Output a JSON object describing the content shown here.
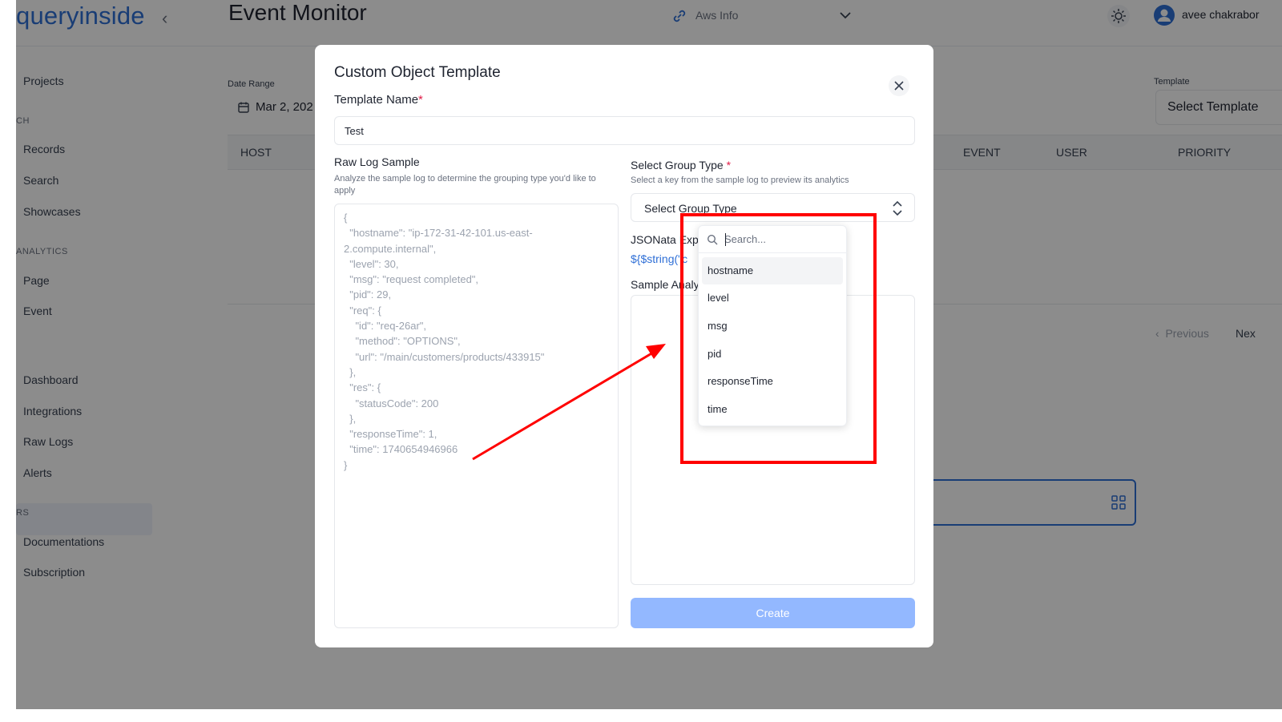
{
  "app": {
    "logo": "queryinside",
    "collapse_glyph": "‹",
    "page_title": "Event Monitor",
    "aws_selector": "Aws Info",
    "user_name": "avee chakrabor"
  },
  "sidebar": {
    "items": [
      {
        "label": "Projects"
      },
      {
        "label": "CH"
      },
      {
        "label": "Records"
      },
      {
        "label": "Search"
      },
      {
        "label": "Showcases"
      },
      {
        "label": "ANALYTICS"
      },
      {
        "label": "Page"
      },
      {
        "label": "Event"
      },
      {
        "label": "Dashboard"
      },
      {
        "label": "Integrations"
      },
      {
        "label": "Raw Logs"
      },
      {
        "label": "Alerts"
      },
      {
        "label": "RS"
      },
      {
        "label": "Documentations"
      },
      {
        "label": "Subscription"
      }
    ]
  },
  "filters": {
    "date_range_label": "Date Range",
    "date_range_value": "Mar 2, 202",
    "template_label": "Template",
    "template_value": "Select Template"
  },
  "table": {
    "headers": [
      "HOST",
      "EVENT",
      "USER",
      "PRIORITY"
    ]
  },
  "pager": {
    "previous": "Previous",
    "next": "Nex"
  },
  "modal": {
    "title": "Custom Object Template",
    "template_name_label": "Template Name",
    "required_mark": "*",
    "template_name_value": "Test",
    "raw_log_label": "Raw Log Sample",
    "raw_log_help": "Analyze the sample log to determine the grouping type you'd like to apply",
    "raw_log_code": "{\n  \"hostname\": \"ip-172-31-42-101.us-east-\n2.compute.internal\",\n  \"level\": 30,\n  \"msg\": \"request completed\",\n  \"pid\": 29,\n  \"req\": {\n    \"id\": \"req-26ar\",\n    \"method\": \"OPTIONS\",\n    \"url\": \"/main/customers/products/433915\"\n  },\n  \"res\": {\n    \"statusCode\": 200\n  },\n  \"responseTime\": 1,\n  \"time\": 1740654946966\n}",
    "group_type_label": "Select Group Type",
    "group_type_help": "Select a key from the sample log to preview its analytics",
    "group_type_value": "Select Group Type",
    "jsonata_label": "JSONata Expr",
    "jsonata_expr": "${$string(\"c",
    "sample_analytics_label": "Sample Analy",
    "create_label": "Create"
  },
  "dropdown": {
    "search_placeholder": "Search...",
    "options": [
      "hostname",
      "level",
      "msg",
      "pid",
      "responseTime",
      "time"
    ],
    "highlighted": "hostname"
  },
  "colors": {
    "accent": "#2f6fd6",
    "create_button": "#93b8ff",
    "annotation": "#ff0000",
    "required": "#e11d48"
  }
}
